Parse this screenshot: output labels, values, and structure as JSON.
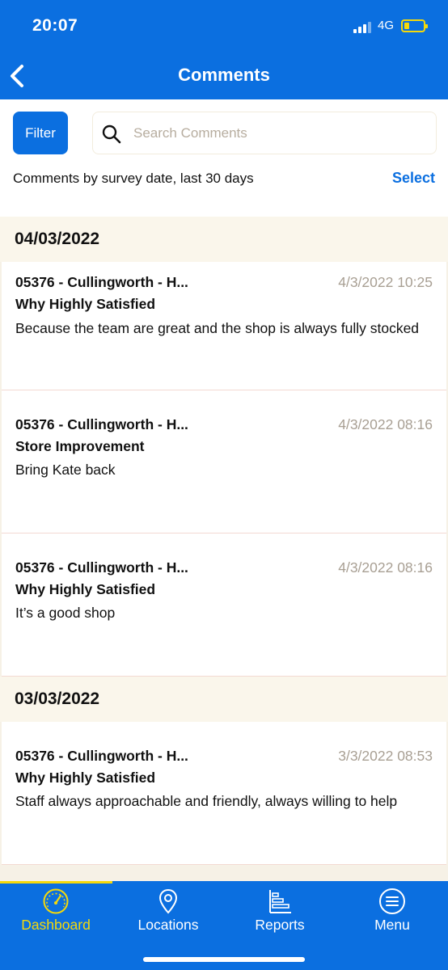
{
  "status_bar": {
    "time": "20:07",
    "network": "4G"
  },
  "header": {
    "title": "Comments"
  },
  "toolbar": {
    "filter_label": "Filter",
    "search_placeholder": "Search Comments"
  },
  "period": {
    "text": "Comments by survey date, last 30 days",
    "select_label": "Select"
  },
  "groups": [
    {
      "date": "04/03/2022",
      "comments": [
        {
          "store": "05376 - Cullingworth - H...",
          "timestamp": "4/3/2022 10:25",
          "question": "Why Highly Satisfied",
          "text": "Because the team are great and the shop is always fully stocked"
        },
        {
          "store": "05376 - Cullingworth - H...",
          "timestamp": "4/3/2022 08:16",
          "question": "Store Improvement",
          "text": "Bring Kate back"
        },
        {
          "store": "05376 - Cullingworth - H...",
          "timestamp": "4/3/2022 08:16",
          "question": "Why Highly Satisfied",
          "text": "It’s a good shop"
        }
      ]
    },
    {
      "date": "03/03/2022",
      "comments": [
        {
          "store": "05376 - Cullingworth - H...",
          "timestamp": "3/3/2022 08:53",
          "question": "Why Highly Satisfied",
          "text": "Staff always approachable and friendly, always willing to help"
        }
      ]
    }
  ],
  "tabs": [
    {
      "label": "Dashboard",
      "icon": "dashboard-gauge-icon",
      "active": true
    },
    {
      "label": "Locations",
      "icon": "location-pin-icon",
      "active": false
    },
    {
      "label": "Reports",
      "icon": "bar-chart-icon",
      "active": false
    },
    {
      "label": "Menu",
      "icon": "menu-icon",
      "active": false
    }
  ],
  "colors": {
    "primary": "#0b6fe0",
    "accent": "#f5d90a",
    "date_header_bg": "#faf6eb",
    "timestamp": "#a89f93",
    "placeholder": "#b7ad9f"
  }
}
